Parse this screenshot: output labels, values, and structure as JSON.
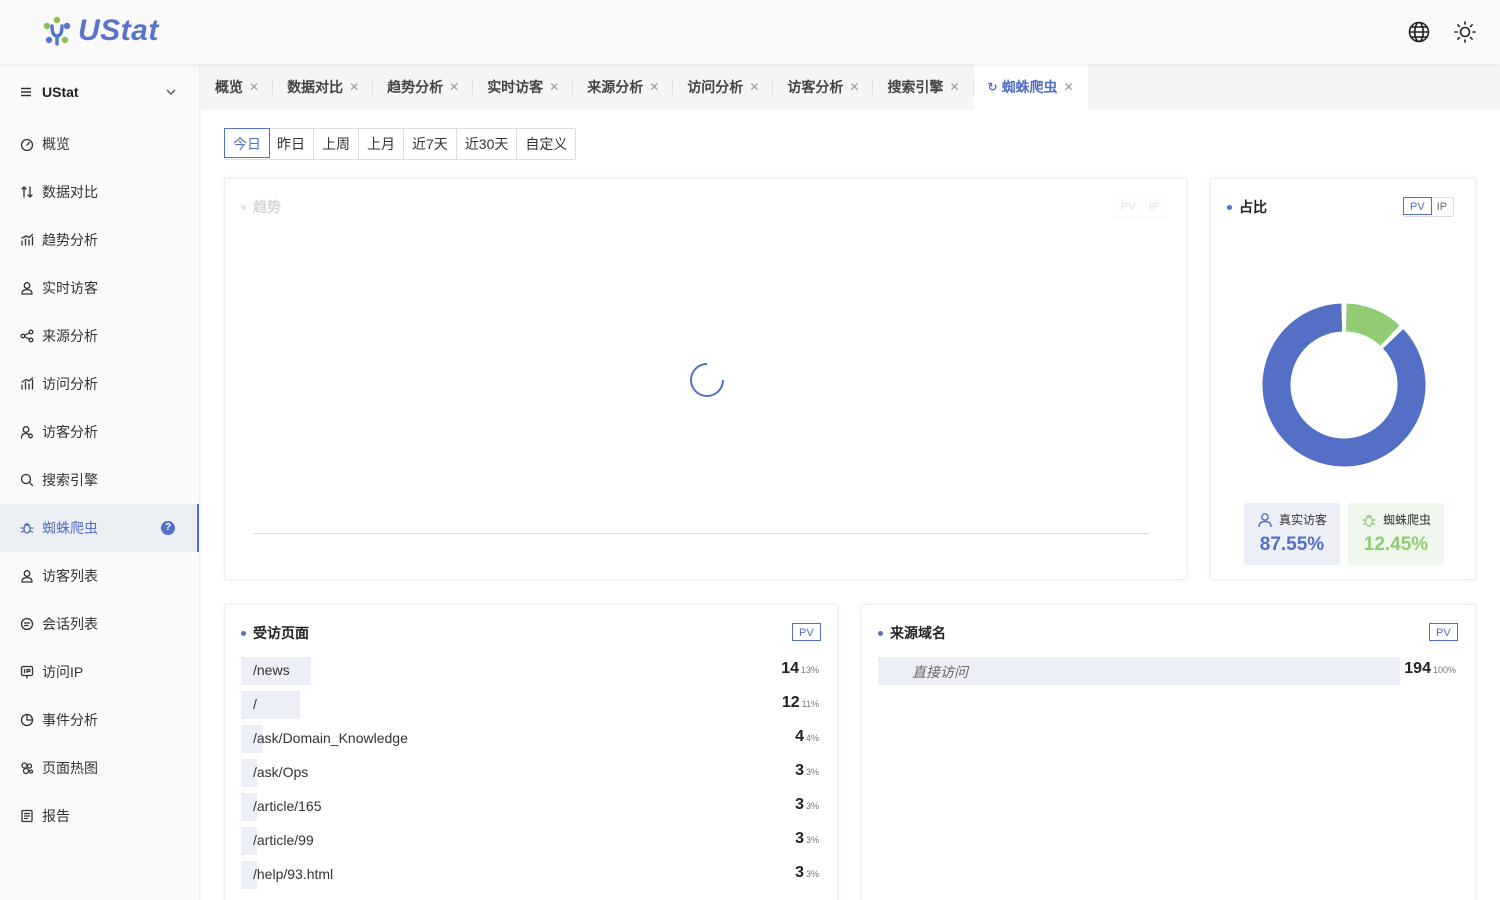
{
  "app": {
    "logo_text": "UStat"
  },
  "header": {
    "language_icon": "globe-icon",
    "theme_icon": "sun-icon"
  },
  "sidebar": {
    "site_selector": "UStat",
    "items": [
      {
        "label": "概览",
        "icon": "dashboard-icon"
      },
      {
        "label": "数据对比",
        "icon": "compare-icon"
      },
      {
        "label": "趋势分析",
        "icon": "trend-chart-icon"
      },
      {
        "label": "实时访客",
        "icon": "user-icon"
      },
      {
        "label": "来源分析",
        "icon": "share-icon"
      },
      {
        "label": "访问分析",
        "icon": "bar-chart-icon"
      },
      {
        "label": "访客分析",
        "icon": "user-search-icon"
      },
      {
        "label": "搜索引擎",
        "icon": "search-icon"
      },
      {
        "label": "蜘蛛爬虫",
        "icon": "bug-icon",
        "active": true,
        "help": "?"
      },
      {
        "label": "访客列表",
        "icon": "user-list-icon"
      },
      {
        "label": "会话列表",
        "icon": "chat-icon"
      },
      {
        "label": "访问IP",
        "icon": "ip-icon"
      },
      {
        "label": "事件分析",
        "icon": "pie-icon"
      },
      {
        "label": "页面热图",
        "icon": "heatmap-icon"
      },
      {
        "label": "报告",
        "icon": "report-icon"
      }
    ]
  },
  "tabs": [
    {
      "label": "概览"
    },
    {
      "label": "数据对比"
    },
    {
      "label": "趋势分析"
    },
    {
      "label": "实时访客"
    },
    {
      "label": "来源分析"
    },
    {
      "label": "访问分析"
    },
    {
      "label": "访客分析"
    },
    {
      "label": "搜索引擎"
    },
    {
      "label": "蜘蛛爬虫",
      "active": true
    }
  ],
  "date_range": {
    "options": [
      "今日",
      "昨日",
      "上周",
      "上月",
      "近7天",
      "近30天",
      "自定义"
    ],
    "selected": "今日"
  },
  "trend_card": {
    "title": "趋势",
    "toggle": [
      "PV",
      "IP"
    ],
    "state": "loading"
  },
  "ratio_card": {
    "title": "占比",
    "toggle": [
      "PV",
      "IP"
    ],
    "selected": "PV",
    "chart_data": {
      "type": "pie",
      "slices": [
        {
          "name": "真实访客",
          "value": 87.55,
          "color": "#5470c6"
        },
        {
          "name": "蜘蛛爬虫",
          "value": 12.45,
          "color": "#91cc75"
        }
      ]
    },
    "legend": [
      {
        "label": "真实访客",
        "value": "87.55%",
        "color": "#5470c6",
        "bg": "#eceff8",
        "icon": "user-icon"
      },
      {
        "label": "蜘蛛爬虫",
        "value": "12.45%",
        "color": "#91cc75",
        "bg": "#f0f7ec",
        "icon": "bug-icon"
      }
    ]
  },
  "pages_card": {
    "title": "受访页面",
    "toggle": "PV",
    "rows": [
      {
        "path": "/news",
        "count": "14",
        "pct": "13%",
        "share": 0.13
      },
      {
        "path": "/",
        "count": "12",
        "pct": "11%",
        "share": 0.11
      },
      {
        "path": "/ask/Domain_Knowledge",
        "count": "4",
        "pct": "4%",
        "share": 0.04
      },
      {
        "path": "/ask/Ops",
        "count": "3",
        "pct": "3%",
        "share": 0.03
      },
      {
        "path": "/article/165",
        "count": "3",
        "pct": "3%",
        "share": 0.03
      },
      {
        "path": "/article/99",
        "count": "3",
        "pct": "3%",
        "share": 0.03
      },
      {
        "path": "/help/93.html",
        "count": "3",
        "pct": "3%",
        "share": 0.03
      }
    ]
  },
  "domains_card": {
    "title": "来源域名",
    "toggle": "PV",
    "rows": [
      {
        "domain": "直接访问",
        "count": "194",
        "pct": "100%",
        "share": 1.0
      }
    ]
  }
}
